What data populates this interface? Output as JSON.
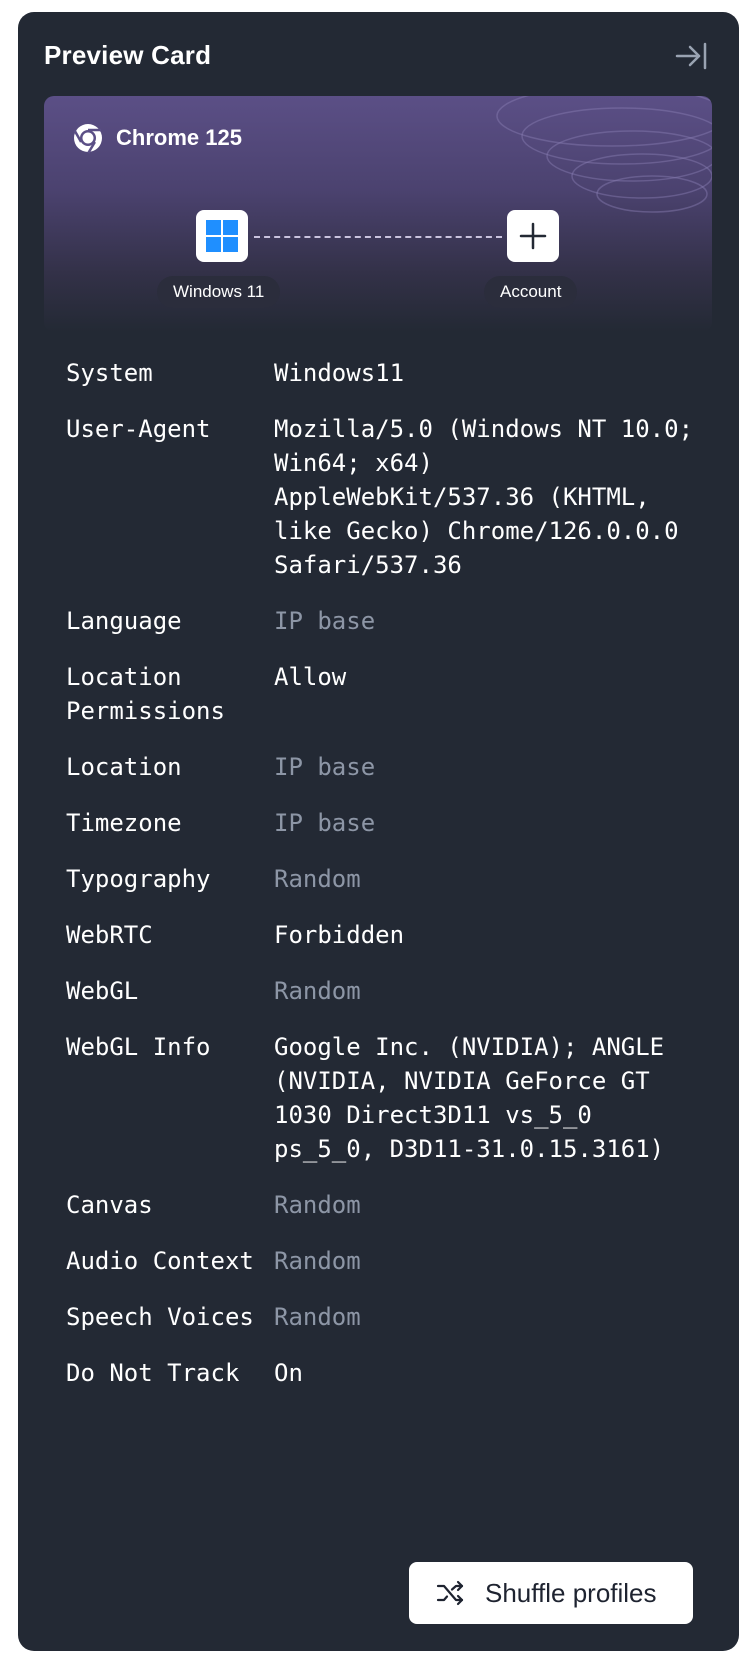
{
  "card": {
    "title": "Preview Card"
  },
  "hero": {
    "browser": "Chrome 125",
    "os_label": "Windows 11",
    "account_label": "Account"
  },
  "details": [
    {
      "label": "System",
      "value": "Windows11",
      "muted": false
    },
    {
      "label": "User-Agent",
      "value": "Mozilla/5.0 (Windows NT 10.0; Win64; x64) AppleWebKit/537.36 (KHTML, like Gecko) Chrome/126.0.0.0 Safari/537.36",
      "muted": false
    },
    {
      "label": "Language",
      "value": "IP base",
      "muted": true
    },
    {
      "label": "Location Permissions",
      "value": "Allow",
      "muted": false
    },
    {
      "label": "Location",
      "value": "IP base",
      "muted": true
    },
    {
      "label": "Timezone",
      "value": "IP base",
      "muted": true
    },
    {
      "label": "Typography",
      "value": "Random",
      "muted": true
    },
    {
      "label": "WebRTC",
      "value": "Forbidden",
      "muted": false
    },
    {
      "label": "WebGL",
      "value": "Random",
      "muted": true
    },
    {
      "label": "WebGL Info",
      "value": "Google Inc. (NVIDIA); ANGLE (NVIDIA, NVIDIA GeForce GT 1030 Direct3D11 vs_5_0 ps_5_0, D3D11-31.0.15.3161)",
      "muted": false
    },
    {
      "label": "Canvas",
      "value": "Random",
      "muted": true
    },
    {
      "label": "Audio Context",
      "value": "Random",
      "muted": true
    },
    {
      "label": "Speech Voices",
      "value": "Random",
      "muted": true
    },
    {
      "label": "Do Not Track",
      "value": "On",
      "muted": false
    }
  ],
  "actions": {
    "shuffle_label": "Shuffle profiles"
  },
  "icons": {
    "collapse": "collapse-panel-icon",
    "browser": "chrome-icon",
    "os": "windows-icon",
    "account": "plus-icon",
    "shuffle": "shuffle-icon"
  },
  "colors": {
    "card_bg": "#232934",
    "muted_text": "#8d96a6",
    "windows_blue": "#1f8fff",
    "hero_purple": "#5b4f86"
  }
}
